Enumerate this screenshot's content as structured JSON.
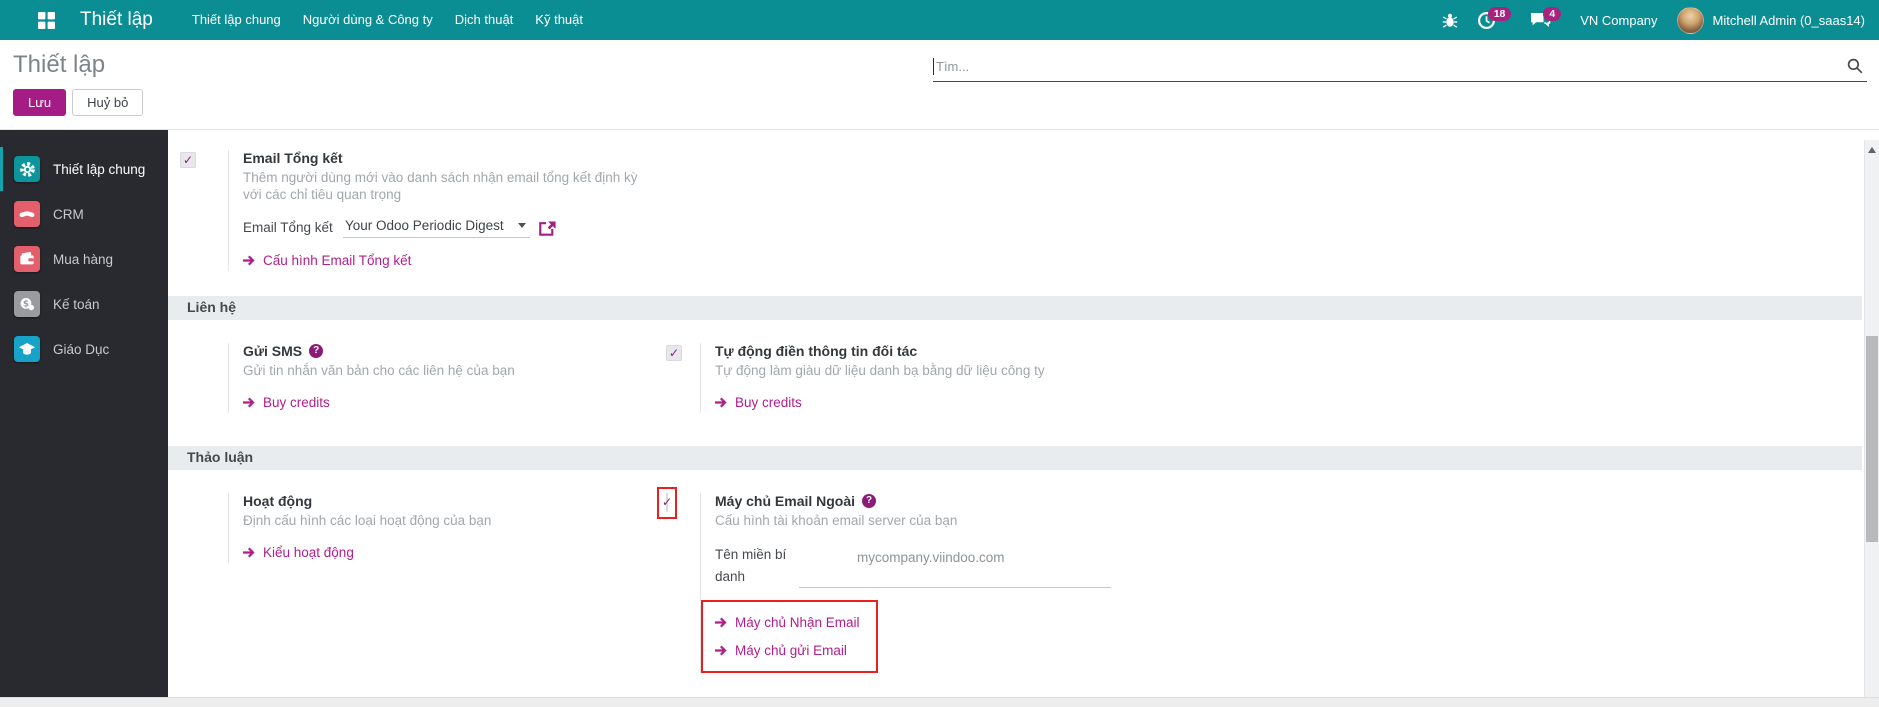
{
  "topbar": {
    "app_title": "Thiết lập",
    "menu": [
      "Thiết lập chung",
      "Người dùng & Công ty",
      "Dịch thuật",
      "Kỹ thuật"
    ],
    "activities_badge": "18",
    "messages_badge": "4",
    "company": "VN Company",
    "user": "Mitchell Admin (0_saas14)"
  },
  "control_panel": {
    "page_title": "Thiết lập",
    "save_label": "Lưu",
    "discard_label": "Huỷ bỏ",
    "search_placeholder": "Tìm..."
  },
  "sidebar": {
    "items": [
      {
        "label": "Thiết lập chung",
        "icon": "gear-icon",
        "active": true
      },
      {
        "label": "CRM",
        "icon": "handshake-icon",
        "active": false
      },
      {
        "label": "Mua hàng",
        "icon": "wallet-icon",
        "active": false
      },
      {
        "label": "Kế toán",
        "icon": "coins-icon",
        "active": false
      },
      {
        "label": "Giáo Dục",
        "icon": "graduation-cap-icon",
        "active": false
      }
    ]
  },
  "settings": {
    "digest": {
      "checked": true,
      "title": "Email Tổng kết",
      "description": "Thêm người dùng mới vào danh sách nhận email tổng kết định kỳ với các chỉ tiêu quan trọng",
      "field_label": "Email Tổng kết",
      "field_value": "Your Odoo Periodic Digest",
      "link_label": "Cấu hình Email Tổng kết"
    },
    "contacts_section": "Liên hệ",
    "sms": {
      "title": "Gửi SMS",
      "description": "Gửi tin nhắn văn bản cho các liên hệ của bạn",
      "link_label": "Buy credits"
    },
    "partner_autocomplete": {
      "checked": true,
      "title": "Tự động điền thông tin đối tác",
      "description": "Tự động làm giàu dữ liệu danh bạ bằng dữ liệu công ty",
      "link_label": "Buy credits"
    },
    "discuss_section": "Thảo luận",
    "activities": {
      "title": "Hoạt động",
      "description": "Định cấu hình các loại hoạt động của bạn",
      "link_label": "Kiểu hoạt động"
    },
    "external_email": {
      "checked": true,
      "highlighted": true,
      "title": "Máy chủ Email Ngoài",
      "description": "Cấu hình tài khoản email server của bạn",
      "alias_label": "Tên miền bí danh",
      "alias_value": "mycompany.viindoo.com",
      "link_incoming": "Máy chủ Nhận Email",
      "link_outgoing": "Máy chủ gửi Email"
    }
  },
  "help_glyph": "?",
  "colors": {
    "topbar_teal": "#0b8d94",
    "accent_magenta": "#a51c84",
    "link_magenta": "#b01d8c",
    "annotation_red": "#e8201e",
    "sidebar_bg": "#292a2f",
    "section_band_bg": "#e9ecef"
  }
}
